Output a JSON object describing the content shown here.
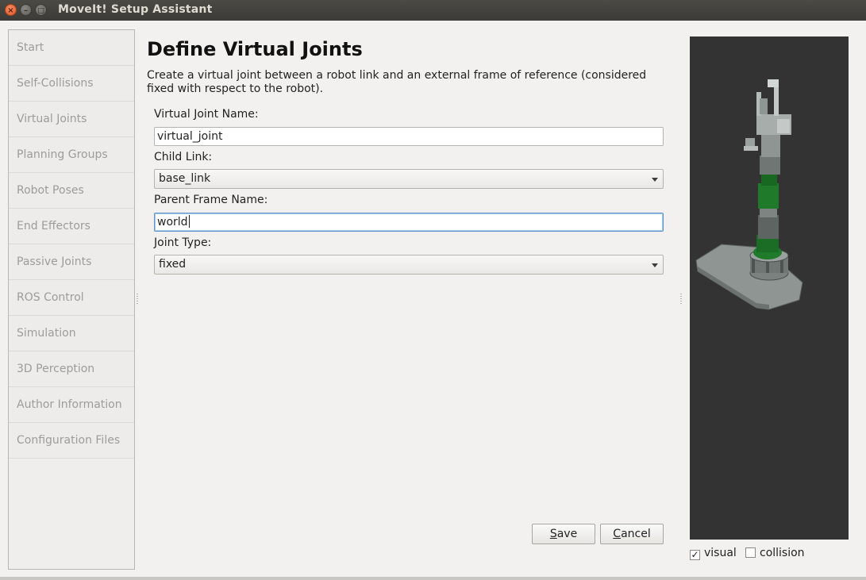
{
  "window": {
    "title": "MoveIt! Setup Assistant",
    "close_glyph": "×",
    "minimize_glyph": "–",
    "maximize_glyph": "□"
  },
  "sidebar": {
    "items": [
      {
        "label": "Start"
      },
      {
        "label": "Self-Collisions"
      },
      {
        "label": "Virtual Joints"
      },
      {
        "label": "Planning Groups"
      },
      {
        "label": "Robot Poses"
      },
      {
        "label": "End Effectors"
      },
      {
        "label": "Passive Joints"
      },
      {
        "label": "ROS Control"
      },
      {
        "label": "Simulation"
      },
      {
        "label": "3D Perception"
      },
      {
        "label": "Author Information"
      },
      {
        "label": "Configuration Files"
      }
    ]
  },
  "main": {
    "title": "Define Virtual Joints",
    "description": "Create a virtual joint between a robot link and an external frame of reference (considered fixed with respect to the robot).",
    "fields": {
      "name_label": "Virtual Joint Name:",
      "name_value": "virtual_joint",
      "child_label": "Child Link:",
      "child_value": "base_link",
      "parent_label": "Parent Frame Name:",
      "parent_value": "world",
      "type_label": "Joint Type:",
      "type_value": "fixed"
    },
    "buttons": {
      "save_label": "ave",
      "save_mnemonic": "S",
      "cancel_label": "ancel",
      "cancel_mnemonic": "C"
    }
  },
  "viewer": {
    "background": "#333333",
    "visual_label": "visual",
    "visual_checked": true,
    "visual_mark": "✓",
    "collision_label": "collision",
    "collision_checked": false
  },
  "colors": {
    "titlebar": "#3c3b37",
    "close_button": "#e05a2a",
    "robot_green": "#1f7a2a",
    "robot_gray": "#8e9593",
    "focus_border": "#5b94cc"
  }
}
